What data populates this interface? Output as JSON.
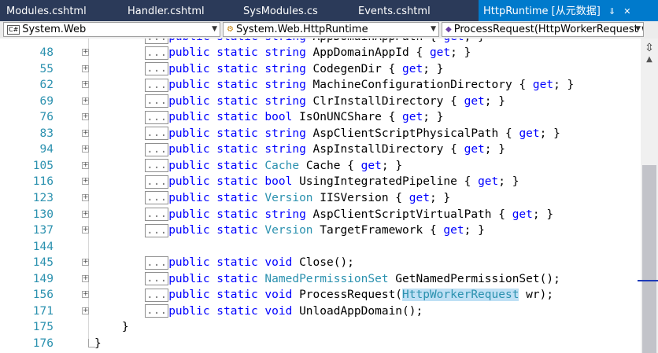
{
  "tabs": [
    {
      "label": "Modules.cshtml"
    },
    {
      "label": "Handler.cshtml"
    },
    {
      "label": "SysModules.cs"
    },
    {
      "label": "Events.cshtml"
    },
    {
      "label": "HttpRuntime [从元数据]"
    }
  ],
  "active_tab_icons": {
    "pin": "pin-icon",
    "close": "close-icon",
    "pin_glyph": "⇓",
    "close_glyph": "✕"
  },
  "navbar": {
    "project": {
      "label": "System.Web",
      "icon": "C#"
    },
    "type": {
      "label": "System.Web.HttpRuntime",
      "icon": "⚙"
    },
    "member": {
      "label": "ProcessRequest(HttpWorkerRequest w",
      "icon": "◆"
    }
  },
  "editor": {
    "lines": [
      {
        "num": "48",
        "fold": "+",
        "parts": [
          [
            "box",
            "..."
          ],
          [
            "kw",
            "public static string "
          ],
          [
            "pl",
            "AppDomainAppId { "
          ],
          [
            "kw",
            "get"
          ],
          [
            "pl",
            "; }"
          ]
        ]
      },
      {
        "num": "55",
        "fold": "+",
        "parts": [
          [
            "box",
            "..."
          ],
          [
            "kw",
            "public static string "
          ],
          [
            "pl",
            "CodegenDir { "
          ],
          [
            "kw",
            "get"
          ],
          [
            "pl",
            "; }"
          ]
        ]
      },
      {
        "num": "62",
        "fold": "+",
        "parts": [
          [
            "box",
            "..."
          ],
          [
            "kw",
            "public static string "
          ],
          [
            "pl",
            "MachineConfigurationDirectory { "
          ],
          [
            "kw",
            "get"
          ],
          [
            "pl",
            "; }"
          ]
        ]
      },
      {
        "num": "69",
        "fold": "+",
        "parts": [
          [
            "box",
            "..."
          ],
          [
            "kw",
            "public static string "
          ],
          [
            "pl",
            "ClrInstallDirectory { "
          ],
          [
            "kw",
            "get"
          ],
          [
            "pl",
            "; }"
          ]
        ]
      },
      {
        "num": "76",
        "fold": "+",
        "parts": [
          [
            "box",
            "..."
          ],
          [
            "kw",
            "public static bool "
          ],
          [
            "pl",
            "IsOnUNCShare { "
          ],
          [
            "kw",
            "get"
          ],
          [
            "pl",
            "; }"
          ]
        ]
      },
      {
        "num": "83",
        "fold": "+",
        "parts": [
          [
            "box",
            "..."
          ],
          [
            "kw",
            "public static string "
          ],
          [
            "pl",
            "AspClientScriptPhysicalPath { "
          ],
          [
            "kw",
            "get"
          ],
          [
            "pl",
            "; }"
          ]
        ]
      },
      {
        "num": "94",
        "fold": "+",
        "parts": [
          [
            "box",
            "..."
          ],
          [
            "kw",
            "public static string "
          ],
          [
            "pl",
            "AspInstallDirectory { "
          ],
          [
            "kw",
            "get"
          ],
          [
            "pl",
            "; }"
          ]
        ]
      },
      {
        "num": "105",
        "fold": "+",
        "parts": [
          [
            "box",
            "..."
          ],
          [
            "kw",
            "public static "
          ],
          [
            "typ",
            "Cache "
          ],
          [
            "pl",
            "Cache { "
          ],
          [
            "kw",
            "get"
          ],
          [
            "pl",
            "; }"
          ]
        ]
      },
      {
        "num": "116",
        "fold": "+",
        "parts": [
          [
            "box",
            "..."
          ],
          [
            "kw",
            "public static bool "
          ],
          [
            "pl",
            "UsingIntegratedPipeline { "
          ],
          [
            "kw",
            "get"
          ],
          [
            "pl",
            "; }"
          ]
        ]
      },
      {
        "num": "123",
        "fold": "+",
        "parts": [
          [
            "box",
            "..."
          ],
          [
            "kw",
            "public static "
          ],
          [
            "typ",
            "Version "
          ],
          [
            "pl",
            "IISVersion { "
          ],
          [
            "kw",
            "get"
          ],
          [
            "pl",
            "; }"
          ]
        ]
      },
      {
        "num": "130",
        "fold": "+",
        "parts": [
          [
            "box",
            "..."
          ],
          [
            "kw",
            "public static string "
          ],
          [
            "pl",
            "AspClientScriptVirtualPath { "
          ],
          [
            "kw",
            "get"
          ],
          [
            "pl",
            "; }"
          ]
        ]
      },
      {
        "num": "137",
        "fold": "+",
        "parts": [
          [
            "box",
            "..."
          ],
          [
            "kw",
            "public static "
          ],
          [
            "typ",
            "Version "
          ],
          [
            "pl",
            "TargetFramework { "
          ],
          [
            "kw",
            "get"
          ],
          [
            "pl",
            "; }"
          ]
        ]
      },
      {
        "num": "144",
        "fold": "",
        "parts": []
      },
      {
        "num": "145",
        "fold": "+",
        "parts": [
          [
            "box",
            "..."
          ],
          [
            "kw",
            "public static void "
          ],
          [
            "pl",
            "Close();"
          ]
        ]
      },
      {
        "num": "149",
        "fold": "+",
        "parts": [
          [
            "box",
            "..."
          ],
          [
            "kw",
            "public static "
          ],
          [
            "typ",
            "NamedPermissionSet "
          ],
          [
            "pl",
            "GetNamedPermissionSet();"
          ]
        ]
      },
      {
        "num": "156",
        "fold": "+",
        "parts": [
          [
            "box",
            "..."
          ],
          [
            "kw",
            "public static void "
          ],
          [
            "pl",
            "ProcessRequest("
          ],
          [
            "hl",
            "HttpWorkerRequest"
          ],
          [
            "pl",
            " wr);"
          ]
        ]
      },
      {
        "num": "171",
        "fold": "+",
        "parts": [
          [
            "box",
            "..."
          ],
          [
            "kw",
            "public static void "
          ],
          [
            "pl",
            "UnloadAppDomain();"
          ]
        ]
      },
      {
        "num": "175",
        "fold": "",
        "parts": [
          [
            "pl",
            "    }"
          ]
        ]
      },
      {
        "num": "176",
        "fold": "",
        "parts": [
          [
            "pl",
            "}"
          ]
        ]
      }
    ]
  },
  "scrollbar": {
    "split_icon": "splitter-icon",
    "split_glyph": "⇳",
    "up_glyph": "▲"
  }
}
